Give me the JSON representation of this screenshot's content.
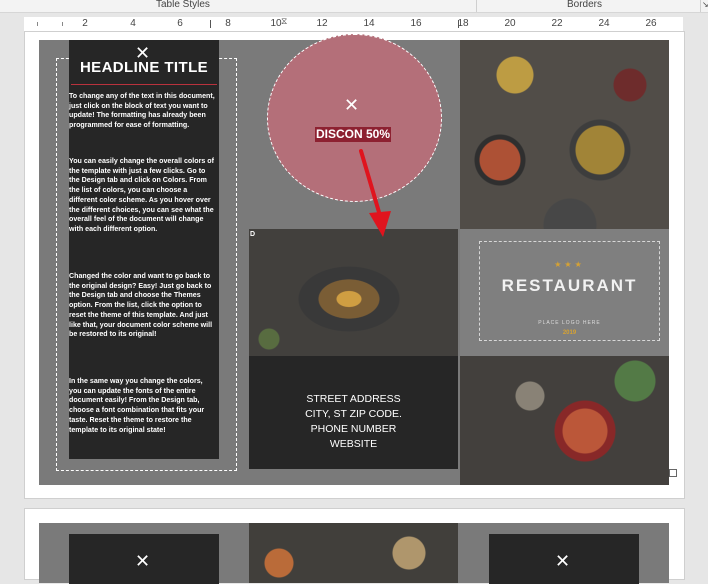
{
  "ribbon": {
    "table_styles": "Table Styles",
    "borders": "Borders"
  },
  "ruler": {
    "numbers": [
      "2",
      "4",
      "6",
      "8",
      "10",
      "12",
      "14",
      "16",
      "18",
      "20",
      "22",
      "24",
      "26"
    ]
  },
  "brochure": {
    "headline": "HEADLINE TITLE",
    "paragraphs": [
      "To change any of the text in this document, just click on the block of text you want to update!  The formatting has already been programmed for ease of formatting.",
      "You can easily change the overall colors of the template with just a few clicks.  Go to the Design tab and click on Colors.  From the list of colors, you can choose a different color scheme.  As you hover over the different choices, you can see what the overall feel of the document will change with each different option.",
      "Changed the color and want to go back to the original design?  Easy!  Just go back to the Design tab and choose the Themes option.  From the list, click the option to reset the theme of this template.  And just like that, your document color scheme will be restored to its original!",
      "In the same way you change the colors, you can update the fonts of the entire document easily!  From the Design tab, choose a font combination that fits your taste.  Reset the theme to restore the template to its original state!"
    ],
    "discount": "DISCON 50%",
    "cell_letter": "D",
    "address_lines": [
      "STREET ADDRESS",
      "CITY, ST ZIP CODE.",
      "PHONE NUMBER",
      "WEBSITE"
    ],
    "logo": {
      "name": "RESTAURANT",
      "sub": "PLACE LOGO HERE",
      "year": "2019"
    },
    "icon": "fork-knife-icon",
    "accent_color": "#b9323d",
    "arrow_color": "#e0141e"
  }
}
